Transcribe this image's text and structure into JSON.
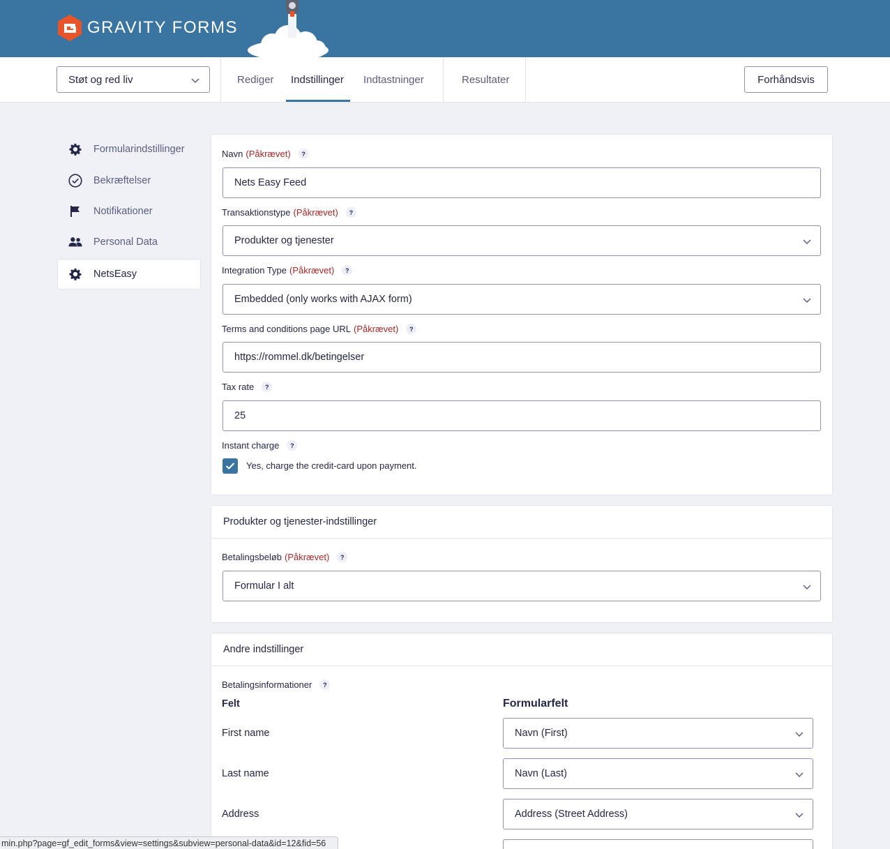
{
  "header": {
    "logo_text": "GRAVITY FORMS",
    "brand_color": "#3a74a0",
    "logo_color": "#e8552b"
  },
  "toolbar": {
    "form_selector": "Støt og red liv",
    "tabs": [
      {
        "label": "Rediger"
      },
      {
        "label": "Indstillinger"
      },
      {
        "label": "Indtastninger"
      },
      {
        "label": "Resultater"
      }
    ],
    "active_tab": "Indstillinger",
    "preview_label": "Forhåndsvis"
  },
  "sidebar": {
    "items": [
      {
        "label": "Formularindstillinger",
        "icon": "gear-icon"
      },
      {
        "label": "Bekræftelser",
        "icon": "check-circle-icon"
      },
      {
        "label": "Notifikationer",
        "icon": "flag-icon"
      },
      {
        "label": "Personal Data",
        "icon": "users-icon"
      },
      {
        "label": "NetsEasy",
        "icon": "gear-icon"
      }
    ],
    "active": "NetsEasy"
  },
  "feed": {
    "required_text": "(Påkrævet)",
    "help_glyph": "?",
    "name": {
      "label": "Navn",
      "value": "Nets Easy Feed"
    },
    "transaction_type": {
      "label": "Transaktionstype",
      "value": "Produkter og tjenester"
    },
    "integration_type": {
      "label": "Integration Type",
      "value": "Embedded (only works with AJAX form)"
    },
    "terms_url": {
      "label": "Terms and conditions page URL",
      "value": "https://rommel.dk/betingelser"
    },
    "tax_rate": {
      "label": "Tax rate",
      "value": "25"
    },
    "instant_charge": {
      "label": "Instant charge",
      "checkbox_label": "Yes, charge the credit-card upon payment.",
      "checked": true
    }
  },
  "products_section": {
    "title": "Produkter og tjenester-indstillinger",
    "payment_amount": {
      "label": "Betalingsbeløb",
      "value": "Formular I alt"
    }
  },
  "other_section": {
    "title": "Andre indstillinger",
    "billing_label": "Betalingsinformationer",
    "col_field": "Felt",
    "col_form_field": "Formularfelt",
    "rows": [
      {
        "field": "First name",
        "value": "Navn (First)"
      },
      {
        "field": "Last name",
        "value": "Navn (Last)"
      },
      {
        "field": "Address",
        "value": "Address (Street Address)"
      }
    ]
  },
  "status_url": "min.php?page=gf_edit_forms&view=settings&subview=personal-data&id=12&fid=56"
}
